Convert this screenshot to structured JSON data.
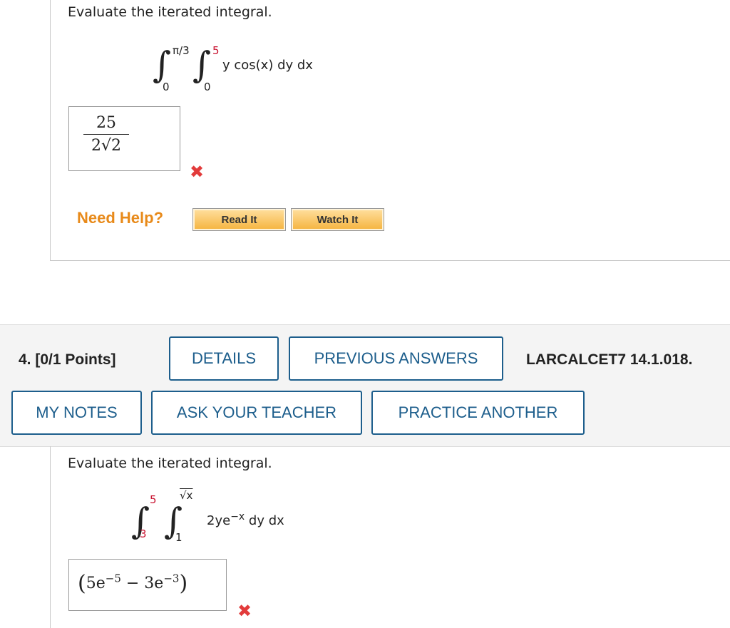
{
  "q3": {
    "prompt": "Evaluate the iterated integral.",
    "outer_upper": "π/3",
    "outer_lower": "0",
    "inner_upper": "5",
    "inner_lower": "0",
    "integrand": "y cos(x) dy dx",
    "answer_numerator": "25",
    "answer_denominator": "2√2",
    "answer_status_icon": "wrong-x-icon",
    "need_help": "Need Help?",
    "read_it": "Read It",
    "watch_it": "Watch It"
  },
  "q4": {
    "number": "4.",
    "points": "[0/1 Points]",
    "details": "DETAILS",
    "previous_answers": "PREVIOUS ANSWERS",
    "reference": "LARCALCET7 14.1.018.",
    "my_notes": "MY NOTES",
    "ask_teacher": "ASK YOUR TEACHER",
    "practice_another": "PRACTICE ANOTHER",
    "prompt": "Evaluate the iterated integral.",
    "outer_upper": "5",
    "outer_lower": "3",
    "inner_upper": "√x",
    "inner_lower": "1",
    "integrand": "2ye",
    "integrand_exp": "−x",
    "integrand_tail": " dy dx",
    "answer_open": "(",
    "answer_a": "5e",
    "answer_a_exp": "−5",
    "answer_minus": " − ",
    "answer_b": "3e",
    "answer_b_exp": "−3",
    "answer_close": ")",
    "answer_status_icon": "wrong-x-icon"
  },
  "colors": {
    "accent_blue": "#1d5e8c",
    "help_orange": "#e88a1a",
    "wrong_red": "#e23b3b",
    "limit_red": "#c8102e"
  }
}
